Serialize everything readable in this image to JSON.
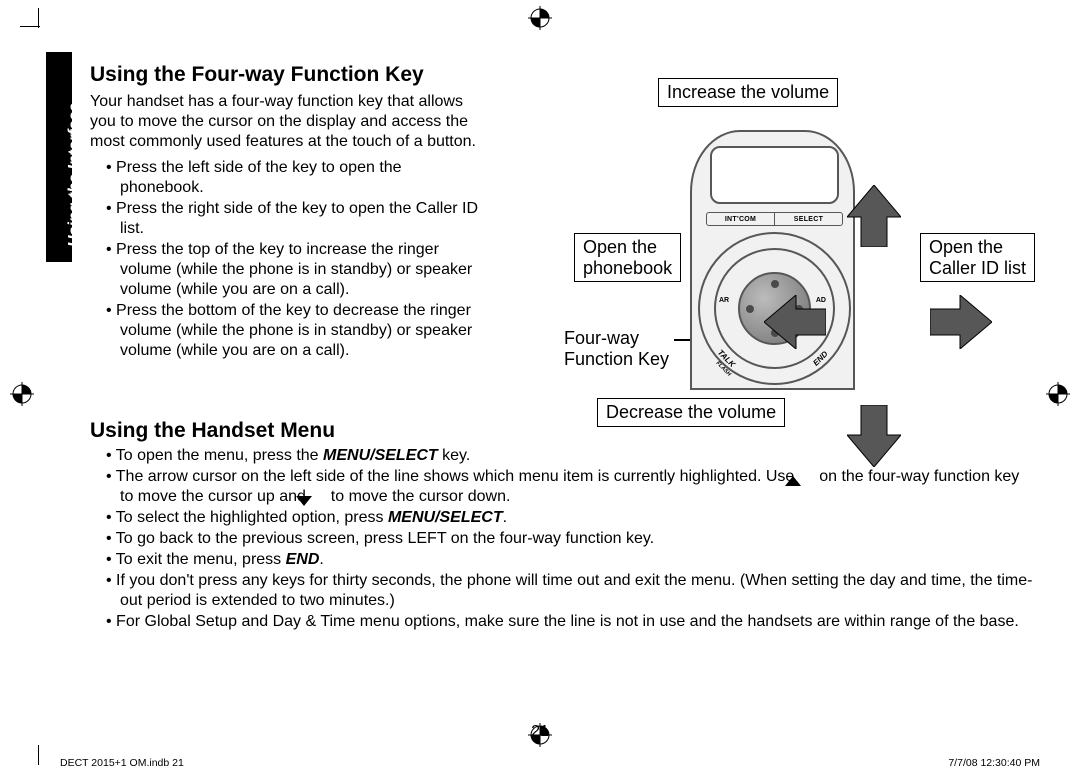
{
  "section_tab": "Using the Interface",
  "section1": {
    "heading": "Using the Four-way Function Key",
    "intro": "Your handset has a four-way function key that allows you to move the cursor on the display and access the most commonly used features at the touch of a button.",
    "bullets": [
      "Press the left side of the key to open the phonebook.",
      "Press the right side of the key to open the Caller ID list.",
      "Press the top of the key to increase the ringer volume (while the phone is in standby) or speaker volume (while you are on a call).",
      "Press the bottom of the key to decrease the ringer volume (while the phone is in standby) or speaker volume (while you are on a call)."
    ]
  },
  "diagram": {
    "label_top": "Increase the volume",
    "label_left_l1": "Open the",
    "label_left_l2": "phonebook",
    "label_right_l1": "Open the",
    "label_right_l2": "Caller ID list",
    "label_bottom": "Decrease the volume",
    "label_fwkey_l1": "Four-way",
    "label_fwkey_l2": "Function Key",
    "softkey_left": "INT'COM",
    "softkey_right": "SELECT",
    "side_left": "AR",
    "side_right": "AD",
    "corner_talk": "TALK",
    "corner_flash": "FLASH",
    "corner_end": "END"
  },
  "section2": {
    "heading": "Using the Handset Menu",
    "b1_a": "To open the menu, press the ",
    "b1_b": "MENU/SELECT",
    "b1_c": " key.",
    "b2_a": "The arrow cursor on the left side of the line shows which menu item is currently highlighted. Use ",
    "b2_b": " on the four-way function key to move the cursor up and ",
    "b2_c": " to move the cursor down.",
    "b3_a": "To select the highlighted option, press ",
    "b3_b": "MENU/SELECT",
    "b3_c": ".",
    "b4": "To go back to the previous screen, press LEFT on the four-way function key.",
    "b5_a": "To exit the menu, press ",
    "b5_b": "END",
    "b5_c": ".",
    "b6": "If you don't press any keys for thirty seconds, the phone will time out and exit the menu. (When setting the day and time, the time-out period is extended to two minutes.)",
    "b7": "For Global Setup and Day & Time menu options, make sure the line is not in use and the handsets are within range of the base."
  },
  "page_number": "21",
  "footer_left": "DECT 2015+1 OM.indb   21",
  "footer_right": "7/7/08   12:30:40 PM"
}
